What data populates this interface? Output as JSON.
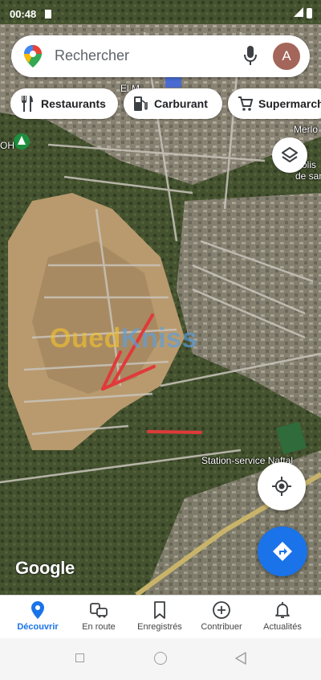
{
  "status_bar": {
    "time": "00:48"
  },
  "search": {
    "placeholder": "Rechercher",
    "avatar_letter": "A"
  },
  "chips": [
    {
      "label": "Restaurants",
      "icon": "restaurant-icon"
    },
    {
      "label": "Carburant",
      "icon": "fuel-pump-icon"
    },
    {
      "label": "Supermarché",
      "icon": "shopping-cart-icon"
    }
  ],
  "map": {
    "labels": {
      "poi_top": "El M",
      "place_right_1": "Merlo",
      "place_right_2": "olis",
      "place_right_3": "de sant",
      "left_edge": "OH",
      "station": "Station-service Naftal"
    },
    "watermark": {
      "part1": "Oued",
      "part2": "Kniss"
    },
    "logo": "Google"
  },
  "bottom_nav": [
    {
      "label": "Découvrir",
      "icon": "location-pin-icon",
      "active": true
    },
    {
      "label": "En route",
      "icon": "commute-icon",
      "active": false
    },
    {
      "label": "Enregistrés",
      "icon": "bookmark-icon",
      "active": false
    },
    {
      "label": "Contribuer",
      "icon": "add-circle-icon",
      "active": false
    },
    {
      "label": "Actualités",
      "icon": "bell-icon",
      "active": false
    }
  ],
  "colors": {
    "accent": "#1a73e8",
    "annotation_red": "#e03a3a",
    "avatar": "#a4665a"
  }
}
